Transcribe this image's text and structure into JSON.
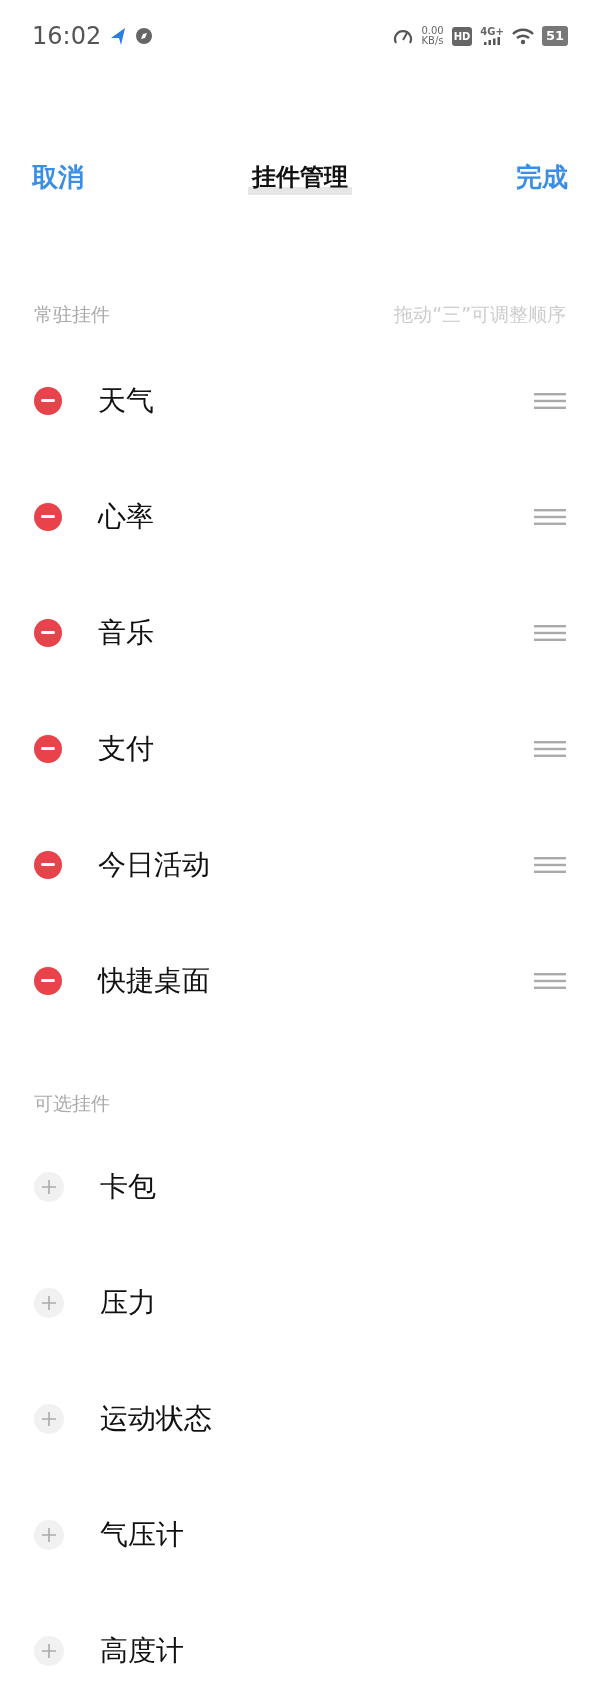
{
  "status_bar": {
    "time": "16:02",
    "speed_value": "0.00",
    "speed_unit": "KB/s",
    "hd": "HD",
    "network": "4G+",
    "battery": "51"
  },
  "header": {
    "cancel": "取消",
    "title": "挂件管理",
    "done": "完成"
  },
  "sections": [
    {
      "kind": "fixed",
      "title": "常驻挂件",
      "hint": "拖动“三”可调整顺序",
      "items": [
        {
          "name": "天气"
        },
        {
          "name": "心率"
        },
        {
          "name": "音乐"
        },
        {
          "name": "支付"
        },
        {
          "name": "今日活动"
        },
        {
          "name": "快捷桌面"
        }
      ]
    },
    {
      "kind": "optional",
      "title": "可选挂件",
      "items": [
        {
          "name": "卡包"
        },
        {
          "name": "压力"
        },
        {
          "name": "运动状态"
        },
        {
          "name": "气压计"
        },
        {
          "name": "高度计"
        }
      ]
    }
  ]
}
